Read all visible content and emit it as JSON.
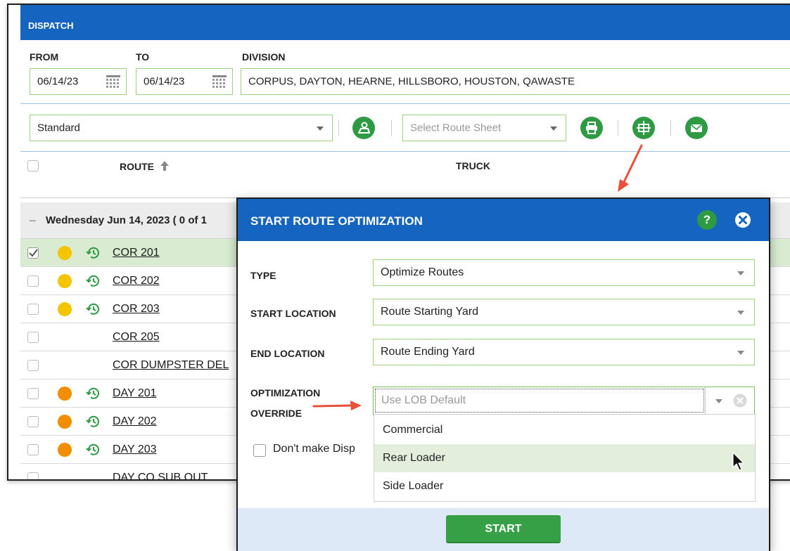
{
  "dispatch": {
    "title": "DISPATCH",
    "from_label": "FROM",
    "from_value": "06/14/23",
    "to_label": "TO",
    "to_value": "06/14/23",
    "division_label": "DIVISION",
    "division_value": "CORPUS, DAYTON, HEARNE, HILLSBORO, HOUSTON, QAWASTE"
  },
  "toolbar": {
    "view_select": "Standard",
    "route_sheet_placeholder": "Select Route Sheet",
    "icons": [
      "map-user-icon",
      "printer-icon",
      "optimize-grid-icon",
      "mail-icon"
    ]
  },
  "table": {
    "col_route": "ROUTE",
    "col_truck": "TRUCK",
    "group_header": "Wednesday Jun 14, 2023 ( 0 of 1",
    "rows": [
      {
        "route": "COR 201",
        "status_color": "#f5c400",
        "checked": true,
        "history": true
      },
      {
        "route": "COR 202",
        "status_color": "#f5c400",
        "checked": false,
        "history": true
      },
      {
        "route": "COR 203",
        "status_color": "#f5c400",
        "checked": false,
        "history": true
      },
      {
        "route": "COR 205",
        "status_color": "",
        "checked": false,
        "history": false
      },
      {
        "route": "COR DUMPSTER DEL",
        "status_color": "",
        "checked": false,
        "history": false
      },
      {
        "route": "DAY 201",
        "status_color": "#f28c00",
        "checked": false,
        "history": true
      },
      {
        "route": "DAY 202",
        "status_color": "#f28c00",
        "checked": false,
        "history": true
      },
      {
        "route": "DAY 203",
        "status_color": "#f28c00",
        "checked": false,
        "history": true
      },
      {
        "route": "DAY CO SUB OUT",
        "status_color": "",
        "checked": false,
        "history": false
      }
    ]
  },
  "modal": {
    "title": "START ROUTE OPTIMIZATION",
    "type_label": "TYPE",
    "type_value": "Optimize Routes",
    "start_label": "START LOCATION",
    "start_value": "Route Starting Yard",
    "end_label": "END LOCATION",
    "end_value": "Route Ending Yard",
    "override_label_1": "OPTIMIZATION",
    "override_label_2": "OVERRIDE",
    "override_placeholder": "Use LOB Default",
    "override_options": [
      "Commercial",
      "Rear Loader",
      "Side Loader"
    ],
    "hovered_option": "Rear Loader",
    "dont_make_label": "Don't make Disp",
    "start_button": "START"
  },
  "colors": {
    "header_blue": "#1565c0",
    "field_border_green": "#9ed07e",
    "button_green": "#36a047",
    "selected_row": "#d9ecd1",
    "annotation_red": "#e8503a"
  }
}
